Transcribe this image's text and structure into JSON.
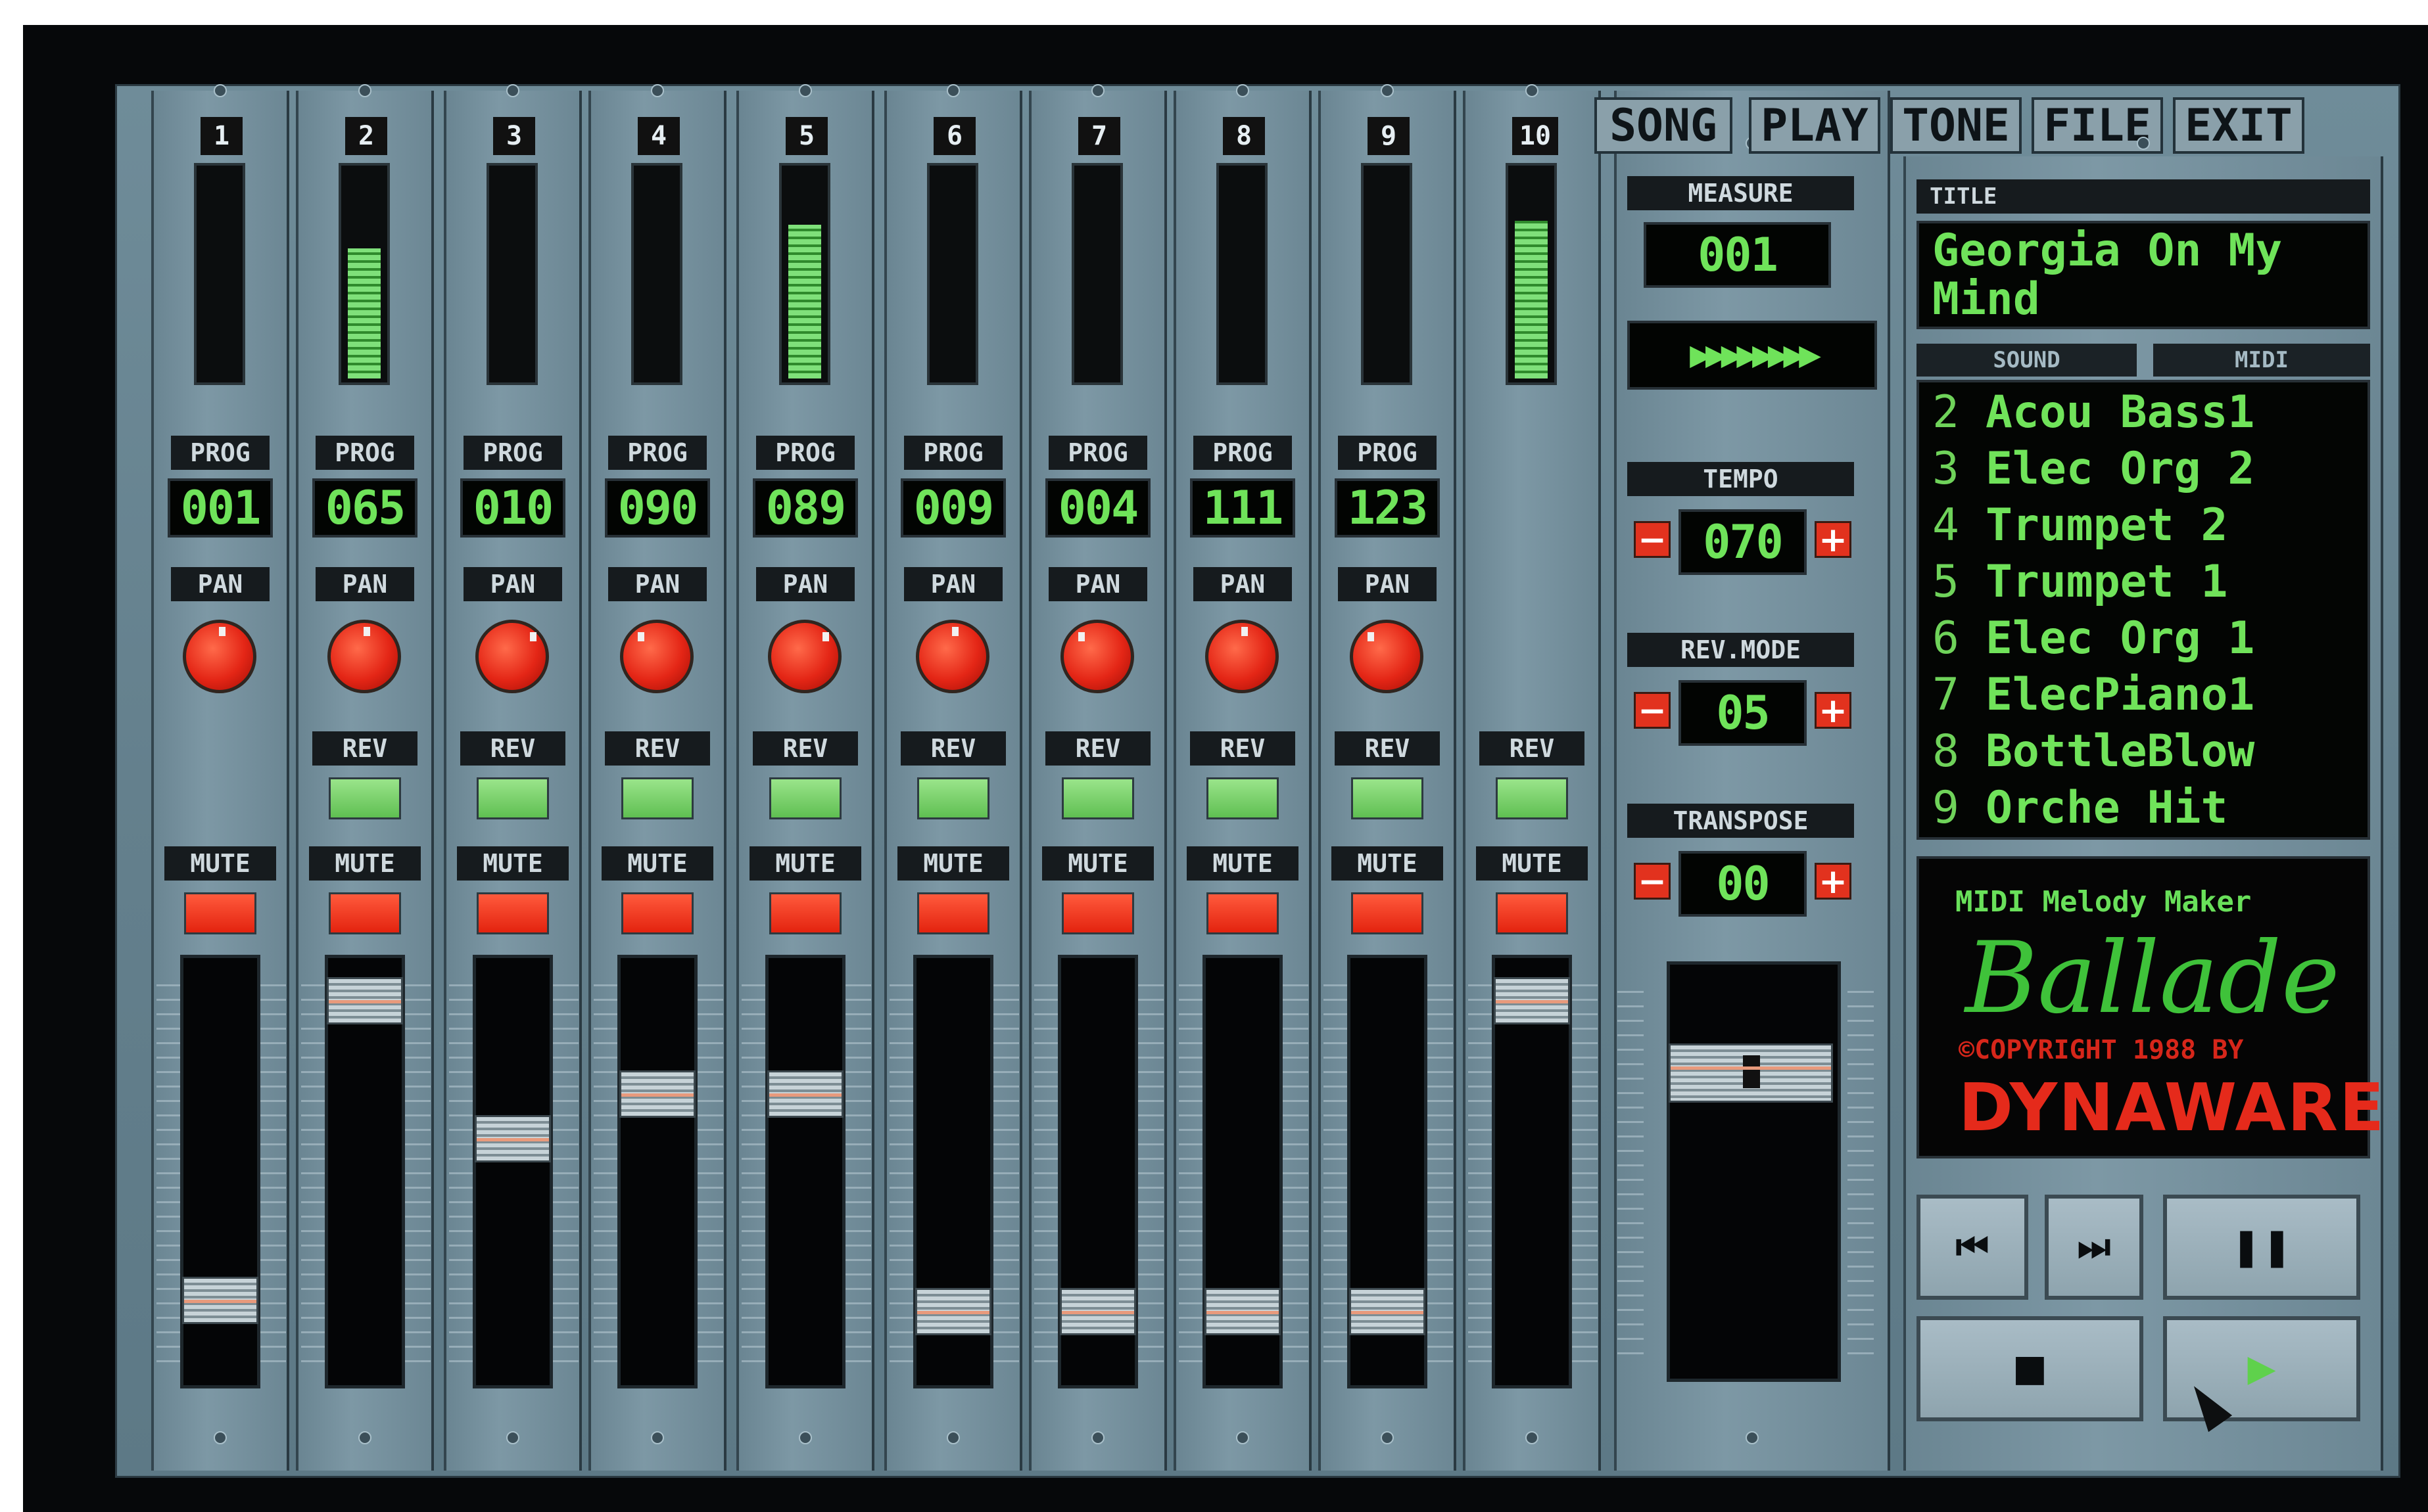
{
  "menu": [
    "SONG",
    "PLAY",
    "TONE",
    "FILE",
    "EXIT"
  ],
  "channels": [
    {
      "num": "1",
      "prog": "001",
      "rev": false,
      "meter": 0.0,
      "fader": 0.85,
      "pan": "center"
    },
    {
      "num": "2",
      "prog": "065",
      "rev": true,
      "meter": 0.62,
      "fader": 0.05,
      "pan": "center"
    },
    {
      "num": "3",
      "prog": "010",
      "rev": true,
      "meter": 0.0,
      "fader": 0.42,
      "pan": "right"
    },
    {
      "num": "4",
      "prog": "090",
      "rev": true,
      "meter": 0.0,
      "fader": 0.3,
      "pan": "left"
    },
    {
      "num": "5",
      "prog": "089",
      "rev": true,
      "meter": 0.73,
      "fader": 0.3,
      "pan": "right"
    },
    {
      "num": "6",
      "prog": "009",
      "rev": true,
      "meter": 0.0,
      "fader": 0.88,
      "pan": "center"
    },
    {
      "num": "7",
      "prog": "004",
      "rev": true,
      "meter": 0.0,
      "fader": 0.88,
      "pan": "left"
    },
    {
      "num": "8",
      "prog": "111",
      "rev": true,
      "meter": 0.0,
      "fader": 0.88,
      "pan": "center"
    },
    {
      "num": "9",
      "prog": "123",
      "rev": true,
      "meter": 0.0,
      "fader": 0.88,
      "pan": "left"
    },
    {
      "num": "10",
      "prog": "",
      "rev": true,
      "meter": 0.75,
      "fader": 0.05,
      "pan": ""
    }
  ],
  "labels": {
    "prog": "PROG",
    "pan": "PAN",
    "rev": "REV",
    "mute": "MUTE"
  },
  "measure": {
    "label": "MEASURE",
    "value": "001"
  },
  "position_arrows": "▶▶▶▶▶▶▶▶",
  "tempo": {
    "label": "TEMPO",
    "value": "070",
    "minus": "−",
    "plus": "+"
  },
  "rev_mode": {
    "label": "REV.MODE",
    "value": "05",
    "minus": "−",
    "plus": "+"
  },
  "transpose": {
    "label": "TRANSPOSE",
    "value": "00",
    "minus": "−",
    "plus": "+"
  },
  "title_box": {
    "label": "TITLE",
    "line1": "Georgia On My",
    "line2": "Mind"
  },
  "list_tabs": {
    "sound": "SOUND",
    "midi": "MIDI"
  },
  "sound_list": [
    {
      "n": "2",
      "name": "Acou Bass1"
    },
    {
      "n": "3",
      "name": "Elec Org 2"
    },
    {
      "n": "4",
      "name": "Trumpet 2"
    },
    {
      "n": "5",
      "name": "Trumpet 1"
    },
    {
      "n": "6",
      "name": "Elec Org 1"
    },
    {
      "n": "7",
      "name": "ElecPiano1"
    },
    {
      "n": "8",
      "name": "BottleBlow"
    },
    {
      "n": "9",
      "name": "Orche Hit"
    }
  ],
  "logo": {
    "tagline": "MIDI Melody Maker",
    "name": "Ballade",
    "copyright": "©COPYRIGHT 1988 BY",
    "company": "DYNAWARE"
  },
  "transport": {
    "prev": "⏮",
    "next": "⏭",
    "pause": "❚❚",
    "stop": "■",
    "play": "▶"
  },
  "colors": {
    "lcd_green": "#6fe35a",
    "red": "#e3230f",
    "panel": "#6f8c99"
  }
}
